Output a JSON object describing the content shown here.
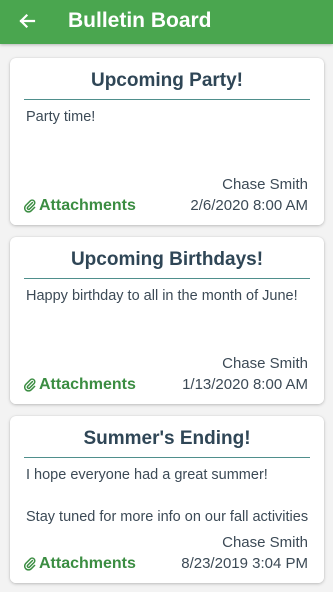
{
  "header": {
    "title": "Bulletin Board",
    "back_icon": "arrow-left-icon"
  },
  "colors": {
    "header_bg": "#4aa64f",
    "accent": "#3b8d42",
    "title_text": "#2f4656",
    "body_text": "#3c4a56"
  },
  "posts": [
    {
      "title": "Upcoming Party!",
      "body": "Party time!",
      "author": "Chase Smith",
      "datetime": "2/6/2020 8:00 AM",
      "attachments_label": "Attachments"
    },
    {
      "title": "Upcoming Birthdays!",
      "body": "Happy birthday to all in the month of June!",
      "author": "Chase Smith",
      "datetime": "1/13/2020 8:00 AM",
      "attachments_label": "Attachments"
    },
    {
      "title": "Summer's Ending!",
      "body": "I hope everyone had a great summer!\n\nStay tuned for more info on our fall activities",
      "author": "Chase Smith",
      "datetime": "8/23/2019 3:04 PM",
      "attachments_label": "Attachments"
    }
  ]
}
